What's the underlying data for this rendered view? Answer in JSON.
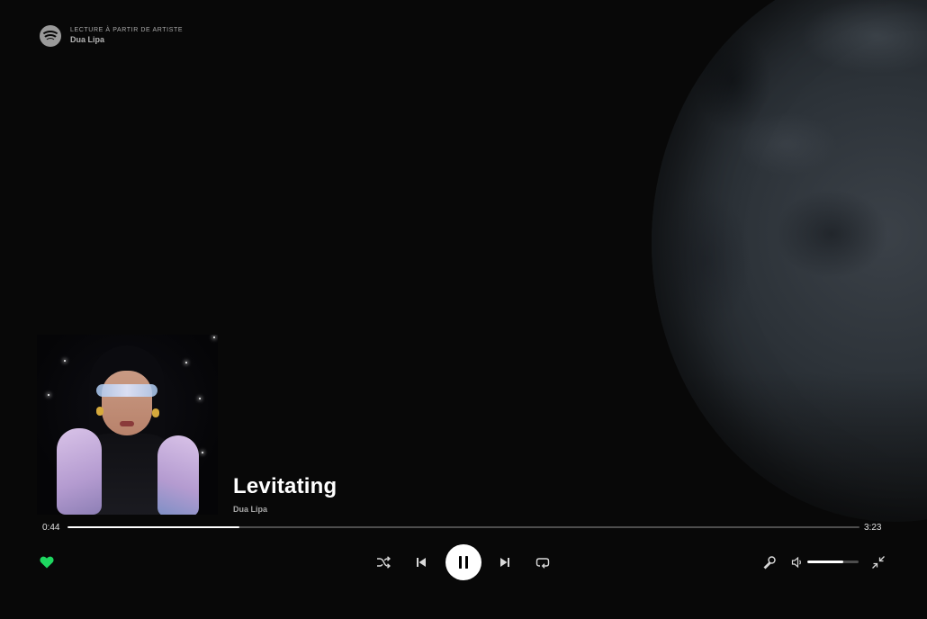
{
  "context": {
    "label": "LECTURE À PARTIR DE ARTISTE",
    "name": "Dua Lipa",
    "logo_icon": "spotify-logo"
  },
  "track": {
    "title": "Levitating",
    "artist": "Dua Lipa"
  },
  "playback": {
    "current_time": "0:44",
    "total_time": "3:23",
    "progress_fraction": 0.2167,
    "state": "playing",
    "liked": true
  },
  "volume": {
    "level_fraction": 0.7
  },
  "controls": {
    "like_icon": "heart-icon",
    "shuffle_icon": "shuffle-icon",
    "previous_icon": "skip-previous-icon",
    "pause_icon": "pause-icon",
    "next_icon": "skip-next-icon",
    "repeat_icon": "repeat-icon",
    "lyrics_icon": "microphone-icon",
    "volume_icon": "volume-icon",
    "minimize_icon": "minimize-icon"
  },
  "colors": {
    "background": "#080808",
    "accent_green": "#1ed760",
    "text_primary": "#ffffff",
    "text_secondary": "#a7a7a7"
  }
}
